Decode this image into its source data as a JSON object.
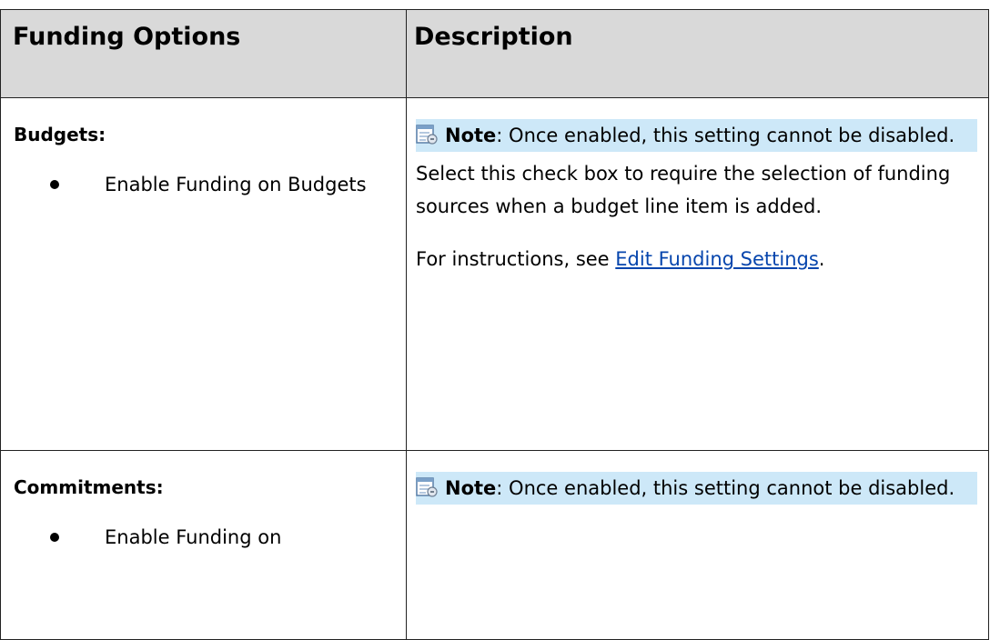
{
  "table": {
    "headers": {
      "funding_options": "Funding Options",
      "description": "Description"
    },
    "rows": [
      {
        "section_title": "Budgets:",
        "option": "Enable Funding on Budgets",
        "note_label": "Note",
        "note_text": ": Once enabled, this setting cannot be disabled.",
        "description": "Select this check box to require the selection of funding sources when a budget line item is added.",
        "instructions_prefix": "For instructions, see ",
        "instructions_link": "Edit Funding Settings",
        "instructions_suffix": "."
      },
      {
        "section_title": "Commitments:",
        "option": "Enable Funding on",
        "note_label": "Note",
        "note_text": ": Once enabled, this setting cannot be disabled."
      }
    ]
  },
  "colors": {
    "header_background": "#d9d9d9",
    "note_background": "#cde8f8",
    "link": "#0645ad"
  },
  "icons": {
    "note": "note-icon"
  }
}
